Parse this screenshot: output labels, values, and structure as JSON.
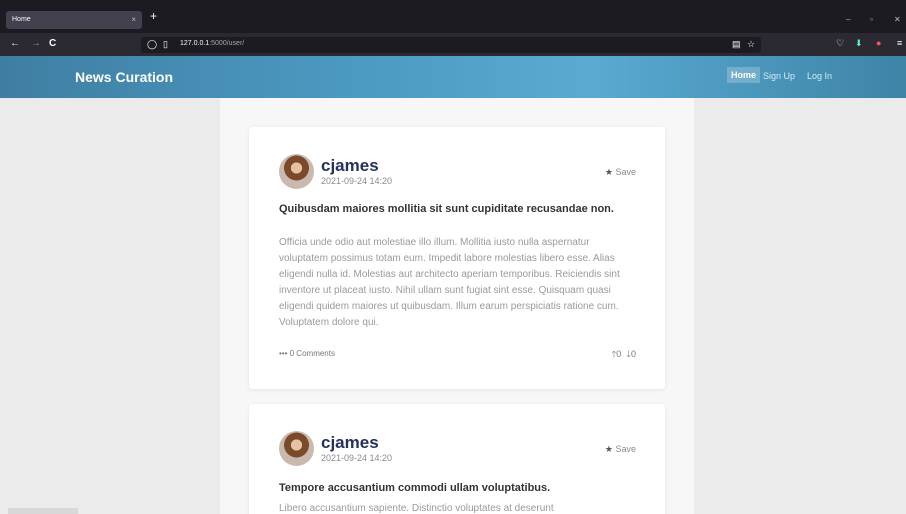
{
  "browser": {
    "tab_title": "Home",
    "tab_close": "×",
    "new_tab": "+",
    "url_host": "127.0.0.1",
    "url_rest": ":5000/user/",
    "back": "←",
    "forward": "→",
    "reload": "C",
    "minimize": "–",
    "restore": "▫",
    "close": "✕"
  },
  "site": {
    "brand": "News Curation",
    "nav": [
      "Home",
      "Sign Up",
      "Log In"
    ]
  },
  "posts": [
    {
      "author": "cjames",
      "date": "2021-09-24 14:20",
      "save_label": "Save",
      "title": "Quibusdam maiores mollitia sit sunt cupiditate recusandae non.",
      "body": "Officia unde odio aut molestiae illo illum. Mollitia iusto nulla aspernatur voluptatem possimus totam eum. Impedit labore molestias libero esse. Alias eligendi nulla id. Molestias aut architecto aperiam temporibus. Reiciendis sint inventore ut placeat iusto. Nihil ullam sunt fugiat sint esse. Quisquam quasi eligendi quidem maiores ut quibusdam. Illum earum perspiciatis ratione cum. Voluptatem dolore qui.",
      "comments": "••• 0 Comments",
      "upvotes": "0",
      "downvotes": "0"
    },
    {
      "author": "cjames",
      "date": "2021-09-24 14:20",
      "save_label": "Save",
      "title": "Tempore accusantium commodi ullam voluptatibus.",
      "body": "Libero accusantium sapiente. Distinctio voluptates at deserunt"
    }
  ]
}
